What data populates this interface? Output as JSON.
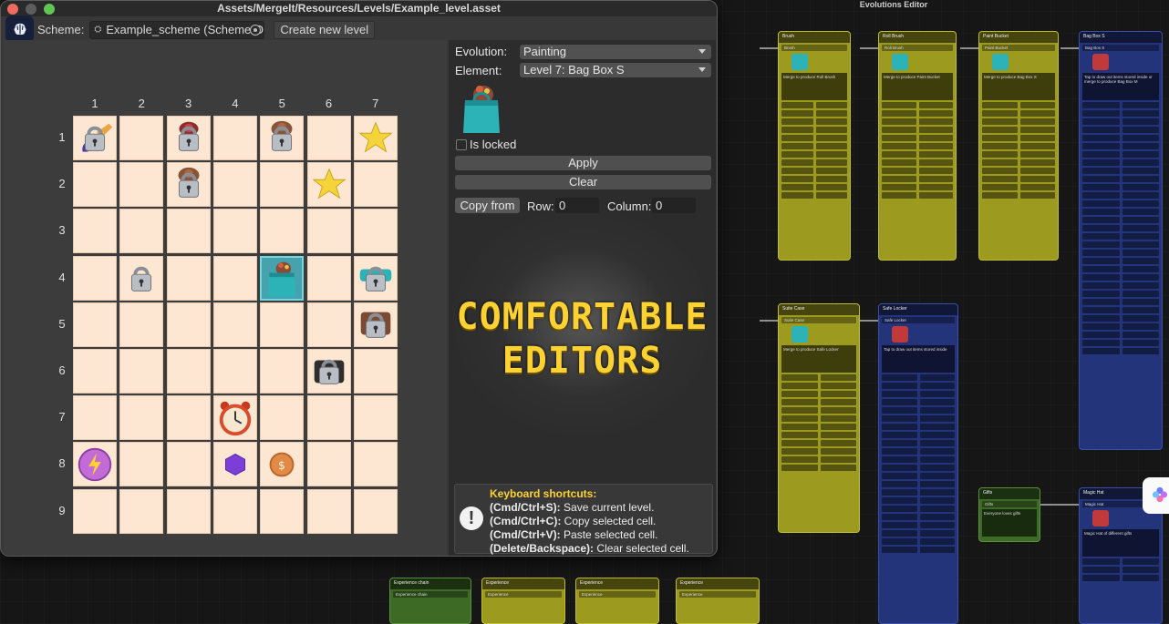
{
  "window": {
    "title": "Assets/MergeIt/Resources/Levels/Example_level.asset"
  },
  "toolbar": {
    "scheme_label": "Scheme:",
    "scheme_value": "Example_scheme (Scheme O",
    "create_level_label": "Create new level"
  },
  "grid": {
    "columns": [
      "1",
      "2",
      "3",
      "4",
      "5",
      "6",
      "7"
    ],
    "rows": [
      "1",
      "2",
      "3",
      "4",
      "5",
      "6",
      "7",
      "8",
      "9"
    ],
    "items": [
      {
        "row": 1,
        "col": 1,
        "icon": "locked-brush-icon"
      },
      {
        "row": 1,
        "col": 3,
        "icon": "locked-bucket-icon"
      },
      {
        "row": 1,
        "col": 5,
        "icon": "locked-bag-icon"
      },
      {
        "row": 1,
        "col": 7,
        "icon": "star-icon"
      },
      {
        "row": 2,
        "col": 3,
        "icon": "locked-bag-icon"
      },
      {
        "row": 2,
        "col": 6,
        "icon": "star-icon"
      },
      {
        "row": 4,
        "col": 2,
        "icon": "lock-icon"
      },
      {
        "row": 4,
        "col": 5,
        "icon": "bag-box-icon",
        "selected": true
      },
      {
        "row": 4,
        "col": 7,
        "icon": "locked-teal-bag-icon"
      },
      {
        "row": 5,
        "col": 7,
        "icon": "locked-suitcase-icon"
      },
      {
        "row": 6,
        "col": 6,
        "icon": "locked-dark-case-icon"
      },
      {
        "row": 7,
        "col": 4,
        "icon": "alarm-clock-icon"
      },
      {
        "row": 8,
        "col": 1,
        "icon": "energy-orb-icon"
      },
      {
        "row": 8,
        "col": 4,
        "icon": "purple-gem-icon"
      },
      {
        "row": 8,
        "col": 5,
        "icon": "coin-icon"
      }
    ]
  },
  "inspector": {
    "evolution_label": "Evolution:",
    "evolution_value": "Painting",
    "element_label": "Element:",
    "element_value": "Level 7: Bag Box S",
    "is_locked_label": "Is locked",
    "apply_label": "Apply",
    "clear_label": "Clear",
    "copy_from_label": "Copy from",
    "row_label": "Row:",
    "row_value": "0",
    "column_label": "Column:",
    "column_value": "0"
  },
  "headline": {
    "line1": "COMFORTABLE",
    "line2": "EDITORS"
  },
  "shortcuts": {
    "title": "Keyboard shortcuts:",
    "lines": [
      {
        "keys": "(Cmd/Ctrl+S):",
        "action": "Save current level."
      },
      {
        "keys": "(Cmd/Ctrl+C):",
        "action": "Copy selected cell."
      },
      {
        "keys": "(Cmd/Ctrl+V):",
        "action": "Paste selected cell."
      },
      {
        "keys": "(Delete/Backspace):",
        "action": "Clear selected cell."
      }
    ]
  },
  "graph": {
    "title": "Evolutions Editor",
    "nodes": [
      {
        "name": "Brush",
        "color": "y",
        "desc": "Merge to produce Roll Brush"
      },
      {
        "name": "Roll Brush",
        "color": "y",
        "desc": "Merge to produce Paint Bucket"
      },
      {
        "name": "Paint Bucket",
        "color": "y",
        "desc": "Merge to produce Bag Box S"
      },
      {
        "name": "Bag Box S",
        "color": "b",
        "desc": "Tap to draw out items stored inside or merge to produce Bag Box M"
      },
      {
        "name": "Suite Case",
        "color": "y",
        "desc": "Merge to produce Safe Locker"
      },
      {
        "name": "Safe Locker",
        "color": "b",
        "desc": "Tap to draw out items stored inside"
      },
      {
        "name": "Gifts",
        "color": "g",
        "desc": "Everyone loves gifts"
      },
      {
        "name": "Magic Hat",
        "color": "b",
        "desc": "Magic Hat of different gifts"
      },
      {
        "name": "Experience chain",
        "color": "g",
        "desc": ""
      },
      {
        "name": "Experience",
        "color": "y",
        "desc": ""
      },
      {
        "name": "Experience",
        "color": "y",
        "desc": ""
      },
      {
        "name": "Experience",
        "color": "y",
        "desc": ""
      }
    ]
  },
  "colors": {
    "cell": "#fde7d3",
    "selected_cell": "#46a3ae",
    "accent_yellow": "#ffd233",
    "node_yellow": "#9c9a1f",
    "node_blue": "#24347a"
  }
}
